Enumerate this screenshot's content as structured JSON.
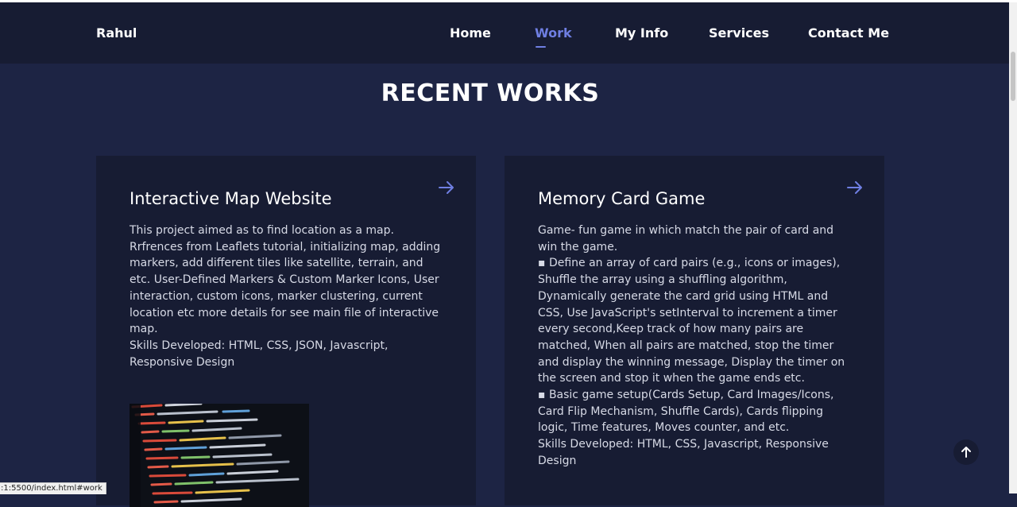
{
  "brand": "Rahul",
  "nav": {
    "items": [
      {
        "label": "Home",
        "active": false
      },
      {
        "label": "Work",
        "active": true
      },
      {
        "label": "My Info",
        "active": false
      },
      {
        "label": "Services",
        "active": false
      },
      {
        "label": "Contact Me",
        "active": false
      }
    ]
  },
  "section": {
    "title": "RECENT WORKS"
  },
  "cards": [
    {
      "title": "Interactive Map Website",
      "icon": "arrow-right-icon",
      "paragraphs": [
        "This project aimed as to find location as a map. Rrfrences from Leaflets tutorial, initializing map, adding markers, add different tiles like satellite, terrain, and etc. User-Defined Markers & Custom Marker Icons, User interaction, custom icons, marker clustering, current location etc more details for see main file of interactive map.",
        "Skills Developed: HTML, CSS, JSON, Javascript, Responsive Design"
      ]
    },
    {
      "title": "Memory Card Game",
      "icon": "arrow-right-icon",
      "paragraphs": [
        "Game- fun game in which match the pair of card and win the game.",
        "▪ Define an array of card pairs (e.g., icons or images), Shuffle the array using a shuffling algorithm, Dynamically generate the card grid using HTML and CSS, Use JavaScript's setInterval to increment a timer every second,Keep track of how many pairs are matched, When all pairs are matched, stop the timer and display the winning message, Display the timer on the screen and stop it when the game ends etc.",
        "▪ Basic game setup(Cards Setup, Card Images/Icons, Card Flip Mechanism, Shuffle Cards), Cards flipping logic, Time features, Moves counter, and etc.",
        "Skills Developed: HTML, CSS, Javascript, Responsive Design"
      ]
    }
  ],
  "scroll_top": {
    "icon": "arrow-up-icon"
  },
  "status_bar": {
    "url": ":1:5500/index.html#work"
  },
  "colors": {
    "background": "#1d2444",
    "card": "#171c33",
    "accent": "#6f7fe3"
  }
}
